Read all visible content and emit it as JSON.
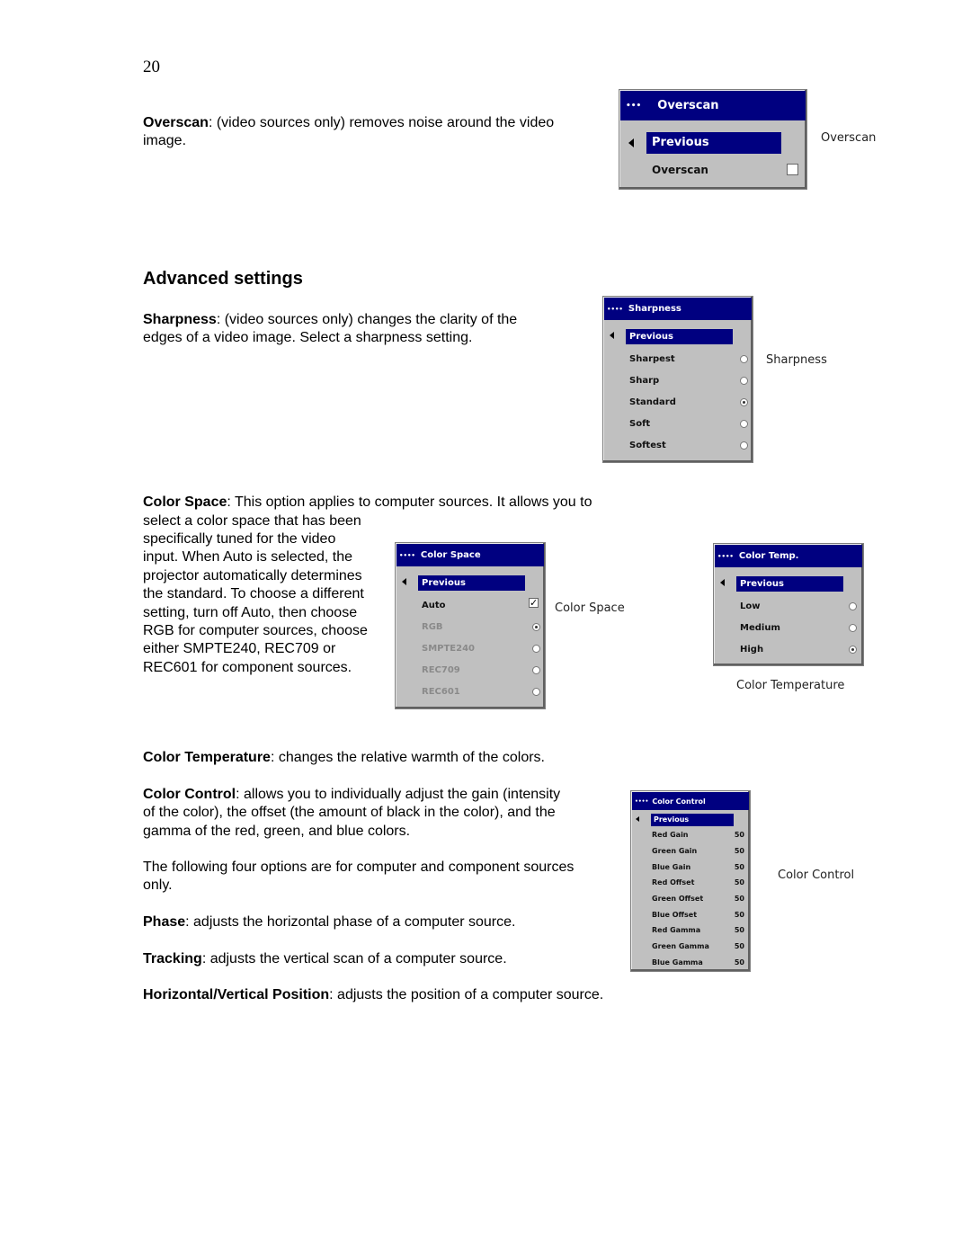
{
  "page_number": "20",
  "overscan": {
    "term": "Overscan",
    "text": ": (video sources only) removes noise around the video image.",
    "menu": {
      "title": "Overscan",
      "header_dots": "•••",
      "previous": "Previous",
      "items": [
        {
          "label": "Overscan",
          "control": "checkbox",
          "checked": false
        }
      ]
    },
    "caption": "Overscan"
  },
  "section_heading": "Advanced settings",
  "sharpness": {
    "term": "Sharpness",
    "text": ": (video sources only) changes the clarity of the edges of a video image. Select a sharpness setting.",
    "menu": {
      "title": "Sharpness",
      "header_dots": "••••",
      "previous": "Previous",
      "items": [
        {
          "label": "Sharpest",
          "selected": false
        },
        {
          "label": "Sharp",
          "selected": false
        },
        {
          "label": "Standard",
          "selected": true
        },
        {
          "label": "Soft",
          "selected": false
        },
        {
          "label": "Softest",
          "selected": false
        }
      ]
    },
    "caption": "Sharpness"
  },
  "color_space": {
    "term": "Color Space",
    "text_first_line": ": This option applies to computer sources. It allows you to",
    "text_rest": "select a color space that has been specifically tuned for the video input. When Auto is selected, the projector automatically determines the standard. To choose a different setting, turn off Auto, then choose RGB for computer sources, choose either SMPTE240, REC709 or REC601 for component sources.",
    "menu": {
      "title": "Color Space",
      "header_dots": "••••",
      "previous": "Previous",
      "auto": {
        "label": "Auto",
        "checked": true
      },
      "items": [
        {
          "label": "RGB",
          "selected": true
        },
        {
          "label": "SMPTE240",
          "selected": false
        },
        {
          "label": "REC709",
          "selected": false
        },
        {
          "label": "REC601",
          "selected": false
        }
      ]
    },
    "caption": "Color Space"
  },
  "color_temp": {
    "term": "Color Temperature",
    "text": ": changes the relative warmth of the colors.",
    "menu": {
      "title": "Color Temp.",
      "header_dots": "••••",
      "previous": "Previous",
      "items": [
        {
          "label": "Low",
          "selected": false
        },
        {
          "label": "Medium",
          "selected": false
        },
        {
          "label": "High",
          "selected": true
        }
      ]
    },
    "caption": "Color Temperature"
  },
  "color_control": {
    "term": "Color Control",
    "text": ": allows you to individually adjust the gain (intensity of the color), the offset (the amount of black in the color), and the gamma of the red, green, and blue colors.",
    "menu": {
      "title": "Color Control",
      "header_dots": "••••",
      "previous": "Previous",
      "items": [
        {
          "label": "Red Gain",
          "value": "50"
        },
        {
          "label": "Green Gain",
          "value": "50"
        },
        {
          "label": "Blue Gain",
          "value": "50"
        },
        {
          "label": "Red Offset",
          "value": "50"
        },
        {
          "label": "Green Offset",
          "value": "50"
        },
        {
          "label": "Blue Offset",
          "value": "50"
        },
        {
          "label": "Red Gamma",
          "value": "50"
        },
        {
          "label": "Green Gamma",
          "value": "50"
        },
        {
          "label": "Blue Gamma",
          "value": "50"
        }
      ]
    },
    "caption": "Color Control"
  },
  "four_options_note": "The following four options are for computer and component sources only.",
  "phase": {
    "term": "Phase",
    "text": ": adjusts the horizontal phase of a computer source."
  },
  "tracking": {
    "term": "Tracking",
    "text": ": adjusts the vertical scan of a computer source."
  },
  "position": {
    "term": "Horizontal/Vertical Position",
    "text": ": adjusts the position of a computer source."
  }
}
